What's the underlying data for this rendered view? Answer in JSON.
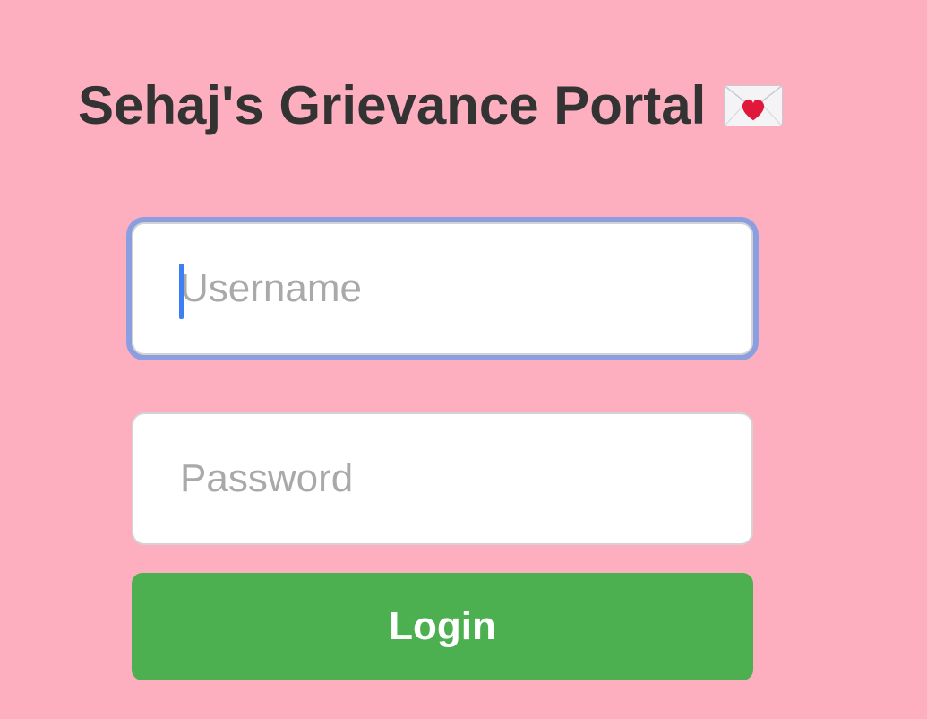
{
  "page": {
    "title": "Sehaj's Grievance Portal",
    "title_icon": "love-letter-icon"
  },
  "form": {
    "username_placeholder": "Username",
    "username_value": "",
    "password_placeholder": "Password",
    "password_value": "",
    "login_label": "Login"
  },
  "colors": {
    "background": "#fdafbf",
    "title_text": "#333333",
    "focus_ring": "#8b9fe0",
    "caret": "#3d7ef5",
    "login_button": "#4caf50",
    "placeholder": "#a9a9a9"
  }
}
